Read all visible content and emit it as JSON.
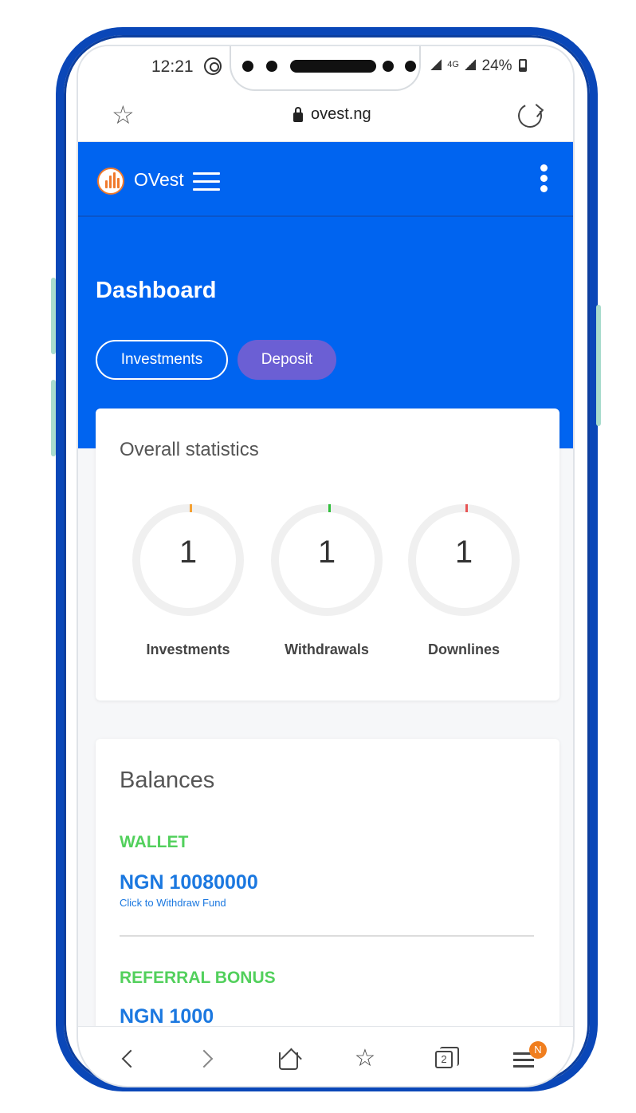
{
  "status_bar": {
    "time": "12:21",
    "network": "4G",
    "battery": "24%"
  },
  "browser": {
    "url": "ovest.ng",
    "tab_count": "2",
    "menu_badge": "N"
  },
  "header": {
    "brand": "OVest"
  },
  "page": {
    "title": "Dashboard",
    "buttons": {
      "investments": "Investments",
      "deposit": "Deposit"
    }
  },
  "stats": {
    "title": "Overall statistics",
    "items": [
      {
        "label": "Investments",
        "value": "1",
        "accent": "#f5a133"
      },
      {
        "label": "Withdrawals",
        "value": "1",
        "accent": "#2fbf3a"
      },
      {
        "label": "Downlines",
        "value": "1",
        "accent": "#e85555"
      }
    ]
  },
  "balances": {
    "title": "Balances",
    "wallet": {
      "label": "WALLET",
      "amount": "NGN 10080000",
      "link": "Click to Withdraw Fund"
    },
    "referral": {
      "label": "REFERRAL BONUS",
      "amount": "NGN 1000"
    }
  },
  "colors": {
    "primary": "#0064f0",
    "deposit_button": "#6b5fd4",
    "balance_label": "#52d05c",
    "balance_amount": "#1b78e0",
    "frame": "#0a47b8"
  }
}
